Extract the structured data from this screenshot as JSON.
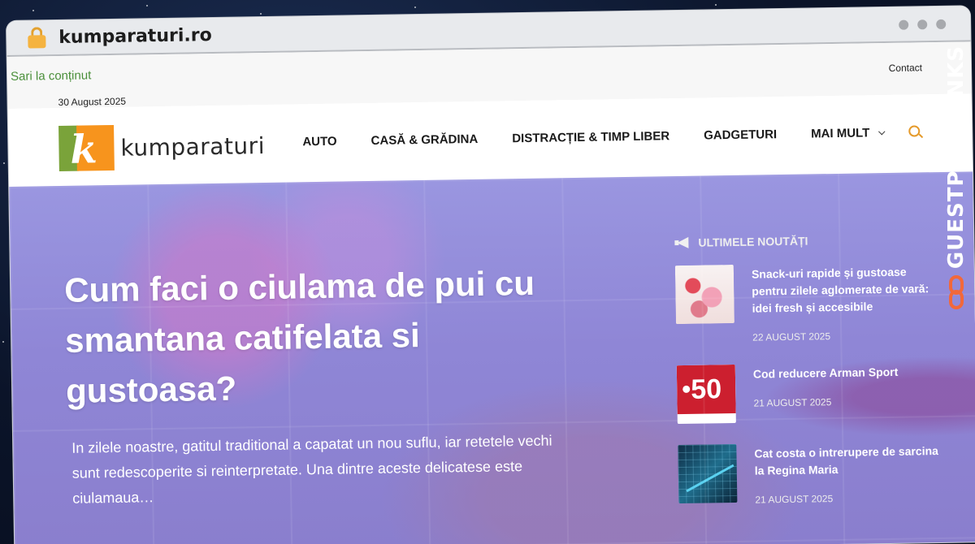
{
  "browser": {
    "url": "kumparaturi.ro"
  },
  "topbar": {
    "skip_link": "Sari la conținut",
    "date": "30 August 2025",
    "contact": "Contact"
  },
  "header": {
    "logo_text": "kumparaturi",
    "logo_letter": "k",
    "nav": [
      {
        "label": "AUTO"
      },
      {
        "label": "CASĂ & GRĂDINA"
      },
      {
        "label": "DISTRACȚIE & TIMP LIBER"
      },
      {
        "label": "GADGETURI"
      },
      {
        "label": "MAI MULT"
      }
    ]
  },
  "hero": {
    "title": "Cum faci o ciulama de pui cu smantana catifelata si gustoasa?",
    "excerpt": "In zilele noastre, gatitul traditional a capatat un nou suflu, iar retetele vechi sunt redescoperite si reinterpretate. Una dintre aceste delicatese este ciulamaua…"
  },
  "news": {
    "heading": "ULTIMELE NOUTĂȚI",
    "items": [
      {
        "title": "Snack-uri rapide și gustoase pentru zilele aglomerate de vară: idei fresh și accesibile",
        "date": "22 AUGUST 2025",
        "thumb": "food"
      },
      {
        "title": "Cod reducere Arman Sport",
        "date": "21 AUGUST 2025",
        "thumb": "sale",
        "thumb_text": "50"
      },
      {
        "title": "Cat costa o intrerupere de sarcina la Regina Maria",
        "date": "21 AUGUST 2025",
        "thumb": "chart"
      }
    ]
  },
  "watermark": {
    "text": "GUESTPOSTLINKS"
  },
  "colors": {
    "accent_orange": "#f7941d",
    "accent_green": "#7aa33a",
    "hero_overlay": "#8f86d6",
    "sale_red": "#cc1f2f"
  }
}
